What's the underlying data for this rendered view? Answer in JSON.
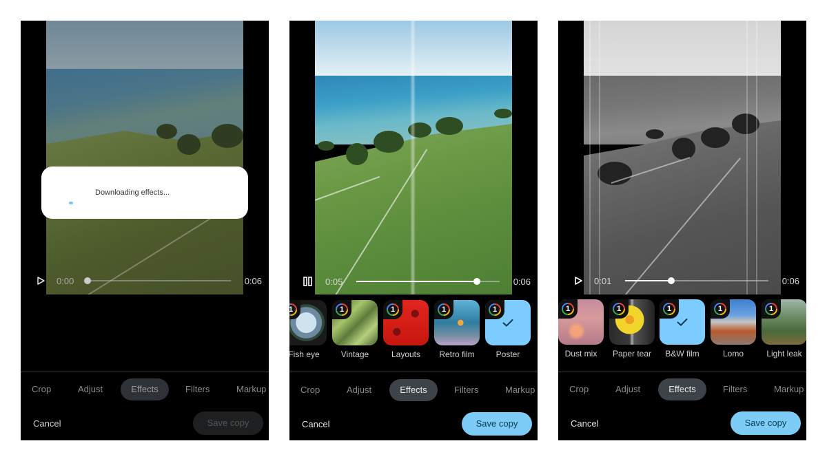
{
  "colors": {
    "accent": "#7cccf6",
    "selected_tile": "#7cccff",
    "background": "#000000",
    "active_tab": "#3d4348"
  },
  "panels": [
    {
      "id": "p1",
      "state": "downloading",
      "dialog": {
        "text": "Downloading effects...",
        "icon": "progress-spinner-icon"
      },
      "video": {
        "play_icon": "play-icon",
        "current_time": "0:00",
        "end_time": "0:06",
        "progress": 0.0
      },
      "tabs": [
        "Crop",
        "Adjust",
        "Effects",
        "Filters",
        "Markup"
      ],
      "active_tab": "Effects",
      "cancel_label": "Cancel",
      "save_label": "Save copy",
      "save_enabled": false
    },
    {
      "id": "p2",
      "state": "poster-applied",
      "video": {
        "play_icon": "pause-icon",
        "current_time": "0:05",
        "end_time": "0:06",
        "progress": 0.84
      },
      "effects": [
        {
          "label": "Fish eye",
          "badge": "1",
          "selected": false
        },
        {
          "label": "Vintage",
          "badge": "1",
          "selected": false
        },
        {
          "label": "Layouts",
          "badge": "1",
          "selected": false
        },
        {
          "label": "Retro film",
          "badge": "1",
          "selected": false
        },
        {
          "label": "Poster",
          "badge": "1",
          "selected": true
        }
      ],
      "tabs": [
        "Crop",
        "Adjust",
        "Effects",
        "Filters",
        "Markup"
      ],
      "active_tab": "Effects",
      "cancel_label": "Cancel",
      "save_label": "Save copy",
      "save_enabled": true
    },
    {
      "id": "p3",
      "state": "bw-film-applied",
      "video": {
        "play_icon": "play-icon",
        "current_time": "0:01",
        "end_time": "0:06",
        "progress": 0.32
      },
      "effects": [
        {
          "label": "Dust mix",
          "badge": "1",
          "selected": false
        },
        {
          "label": "Paper tear",
          "badge": "1",
          "selected": false
        },
        {
          "label": "B&W film",
          "badge": "1",
          "selected": true
        },
        {
          "label": "Lomo",
          "badge": "1",
          "selected": false
        },
        {
          "label": "Light leak",
          "badge": "1",
          "selected": false
        }
      ],
      "tabs": [
        "Crop",
        "Adjust",
        "Effects",
        "Filters",
        "Markup"
      ],
      "active_tab": "Effects",
      "cancel_label": "Cancel",
      "save_label": "Save copy",
      "save_enabled": true
    }
  ]
}
